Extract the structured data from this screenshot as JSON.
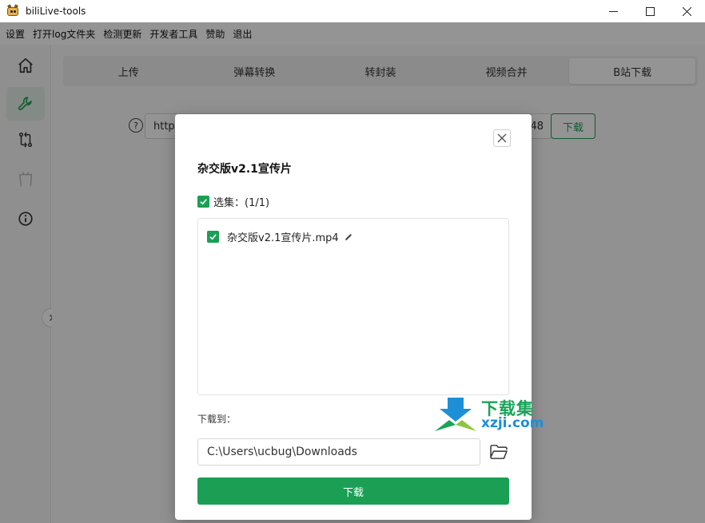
{
  "window": {
    "title": "biliLive-tools"
  },
  "menu": [
    "设置",
    "打开log文件夹",
    "检测更新",
    "开发者工具",
    "赞助",
    "退出"
  ],
  "sidebar": {
    "items": [
      {
        "icon": "home-icon",
        "active": false
      },
      {
        "icon": "wrench-icon",
        "active": true
      },
      {
        "icon": "git-compare-icon",
        "active": false
      },
      {
        "icon": "bilibili-tv-icon",
        "active": false
      },
      {
        "icon": "info-icon",
        "active": false
      }
    ]
  },
  "tabs": [
    {
      "label": "上传",
      "active": false
    },
    {
      "label": "弹幕转换",
      "active": false
    },
    {
      "label": "转封装",
      "active": false
    },
    {
      "label": "视频合并",
      "active": false
    },
    {
      "label": "B站下载",
      "active": true
    }
  ],
  "main": {
    "url_prefix": "http",
    "url_suffix": "48",
    "download_label": "下载"
  },
  "dialog": {
    "title": "杂交版v2.1宣传片",
    "select_all_label": "选集：(1/1)",
    "select_all_checked": true,
    "files": [
      {
        "name": "杂交版v2.1宣传片.mp4",
        "checked": true
      }
    ],
    "save_label": "下载到：",
    "save_path": "C:\\Users\\ucbug\\Downloads",
    "confirm_label": "下载"
  },
  "watermark": {
    "line1": "下载集",
    "line2": "xzji.com"
  },
  "colors": {
    "accent": "#1a9f54",
    "watermark_green": "#1aa35a",
    "watermark_blue": "#1d8fd6"
  }
}
